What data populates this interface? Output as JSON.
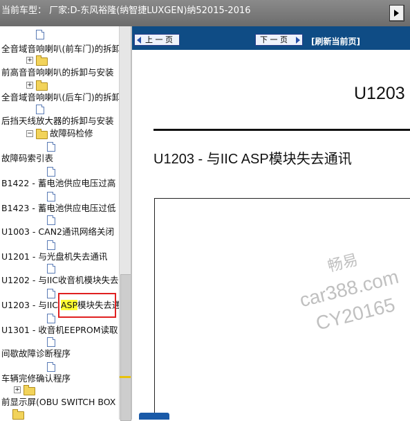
{
  "header": {
    "title": "当前车型： 厂家:D-东风裕隆(纳智捷LUXGEN)纳52015-2016"
  },
  "tree": {
    "items": [
      {
        "type": "doc",
        "indent": 1
      },
      {
        "type": "label",
        "text": "全音域音响喇叭(前车门)的拆卸"
      },
      {
        "type": "folder",
        "indent": 1
      },
      {
        "type": "label",
        "text": "前高音音响喇叭的拆卸与安装"
      },
      {
        "type": "folder",
        "indent": 1
      },
      {
        "type": "label",
        "text": "全音域音响喇叭(后车门)的拆卸"
      },
      {
        "type": "doc",
        "indent": 1
      },
      {
        "type": "label",
        "text": "后挡天线放大器的拆卸与安装"
      },
      {
        "type": "folder-open",
        "text": "故障码检修"
      },
      {
        "type": "doc",
        "indent": 2
      },
      {
        "type": "label",
        "text": "故障码索引表"
      },
      {
        "type": "doc",
        "indent": 2
      },
      {
        "type": "label",
        "text": "B1422 - 蓄电池供应电压过高"
      },
      {
        "type": "doc",
        "indent": 2
      },
      {
        "type": "label",
        "text": "B1423 - 蓄电池供应电压过低"
      },
      {
        "type": "doc",
        "indent": 2
      },
      {
        "type": "label",
        "text": "U1003 - CAN2通讯网络关闭"
      },
      {
        "type": "doc",
        "indent": 2
      },
      {
        "type": "label",
        "text": "U1201 - 与光盘机失去通讯"
      },
      {
        "type": "doc",
        "indent": 2
      },
      {
        "type": "label",
        "text": "U1202 - 与IIC收音机模块失去"
      },
      {
        "type": "doc",
        "indent": 2
      },
      {
        "type": "selected",
        "pre": "U1203 - 与IIC ",
        "hl": "ASP",
        "post": "模块失去通讯"
      },
      {
        "type": "doc",
        "indent": 2
      },
      {
        "type": "label",
        "text": "U1301 - 收音机EEPROM读取"
      },
      {
        "type": "doc",
        "indent": 2
      },
      {
        "type": "label",
        "text": "间歇故障诊断程序"
      },
      {
        "type": "doc",
        "indent": 2
      },
      {
        "type": "label",
        "text": "车辆完修确认程序"
      },
      {
        "type": "folder",
        "indent": 1
      },
      {
        "type": "label",
        "text": "前显示屏(OBU SWITCH BOX"
      },
      {
        "type": "folder",
        "indent": 0
      }
    ]
  },
  "nav": {
    "prev_label": "上 一 页",
    "next_label": "下 一 页",
    "refresh_label": "[刷新当前页]"
  },
  "document": {
    "code": "U1203",
    "title": "U1203 - 与IIC ASP模块失去通讯"
  },
  "watermark": {
    "line1": "畅易",
    "line2": "car388.com",
    "line3": "CY20165"
  }
}
